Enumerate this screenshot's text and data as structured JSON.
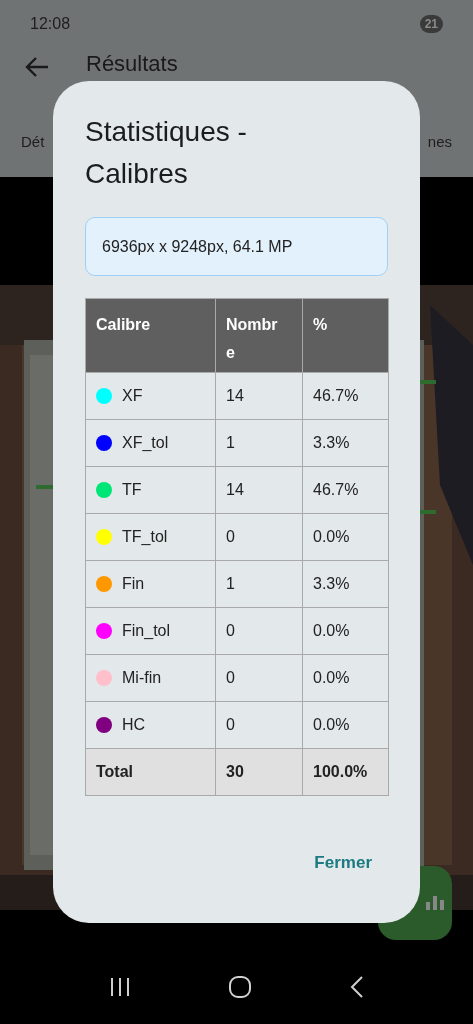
{
  "status_bar": {
    "time": "12:08",
    "battery": "21"
  },
  "app_bar": {
    "title": "Résultats"
  },
  "tabs": [
    {
      "label": "Dét"
    },
    {
      "label": "nes"
    }
  ],
  "dialog": {
    "title": "Statistiques - Calibres",
    "info": "6936px x 9248px, 64.1 MP",
    "table": {
      "columns": [
        "Calibre",
        "Nombre",
        "%"
      ],
      "rows": [
        {
          "calibre": "XF",
          "color": "#00ffff",
          "count": "14",
          "percent": "46.7%"
        },
        {
          "calibre": "XF_tol",
          "color": "#0000ff",
          "count": "1",
          "percent": "3.3%"
        },
        {
          "calibre": "TF",
          "color": "#00e676",
          "count": "14",
          "percent": "46.7%"
        },
        {
          "calibre": "TF_tol",
          "color": "#ffff00",
          "count": "0",
          "percent": "0.0%"
        },
        {
          "calibre": "Fin",
          "color": "#ff9800",
          "count": "1",
          "percent": "3.3%"
        },
        {
          "calibre": "Fin_tol",
          "color": "#ff00ff",
          "count": "0",
          "percent": "0.0%"
        },
        {
          "calibre": "Mi-fin",
          "color": "#ffc0cb",
          "count": "0",
          "percent": "0.0%"
        },
        {
          "calibre": "HC",
          "color": "#800080",
          "count": "0",
          "percent": "0.0%"
        }
      ],
      "total": {
        "label": "Total",
        "count": "30",
        "percent": "100.0%"
      }
    },
    "button": "Fermer"
  }
}
